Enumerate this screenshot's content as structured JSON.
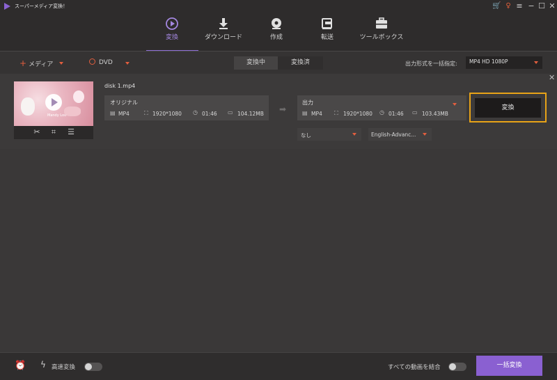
{
  "app": {
    "title": "スーパーメディア変換！"
  },
  "nav": {
    "tabs": [
      {
        "label": "変換",
        "icon": "play-circle-icon",
        "active": true
      },
      {
        "label": "ダウンロード",
        "icon": "download-icon"
      },
      {
        "label": "作成",
        "icon": "disc-icon"
      },
      {
        "label": "転送",
        "icon": "transfer-icon"
      },
      {
        "label": "ツールボックス",
        "icon": "toolbox-icon"
      }
    ]
  },
  "toolbar": {
    "add_media_label": "メディア",
    "dvd_label": "DVD",
    "segment": {
      "converting": "変換中",
      "converted": "変換済"
    },
    "batch_format_label": "出力形式を一括指定:",
    "batch_format_value": "MP4 HD 1080P"
  },
  "file": {
    "name": "disk 1.mp4",
    "thumbnail_text": "Mandy Lou",
    "original": {
      "title": "オリジナル",
      "format": "MP4",
      "resolution": "1920*1080",
      "duration": "01:46",
      "size": "104.12MB"
    },
    "output": {
      "title": "出力",
      "format": "MP4",
      "resolution": "1920*1080",
      "duration": "01:46",
      "size": "103.43MB"
    },
    "convert_label": "変換",
    "subtitle_value": "なし",
    "audio_value": "English-Advanc..."
  },
  "footer": {
    "fast_convert_label": "高速変換",
    "merge_label": "すべての動画を結合",
    "convert_all_label": "一括変換",
    "fast_convert_on": false,
    "merge_on": false
  },
  "colors": {
    "accent": "#8a60d1",
    "highlight": "#e8a317",
    "arrow": "#e25e3e"
  }
}
